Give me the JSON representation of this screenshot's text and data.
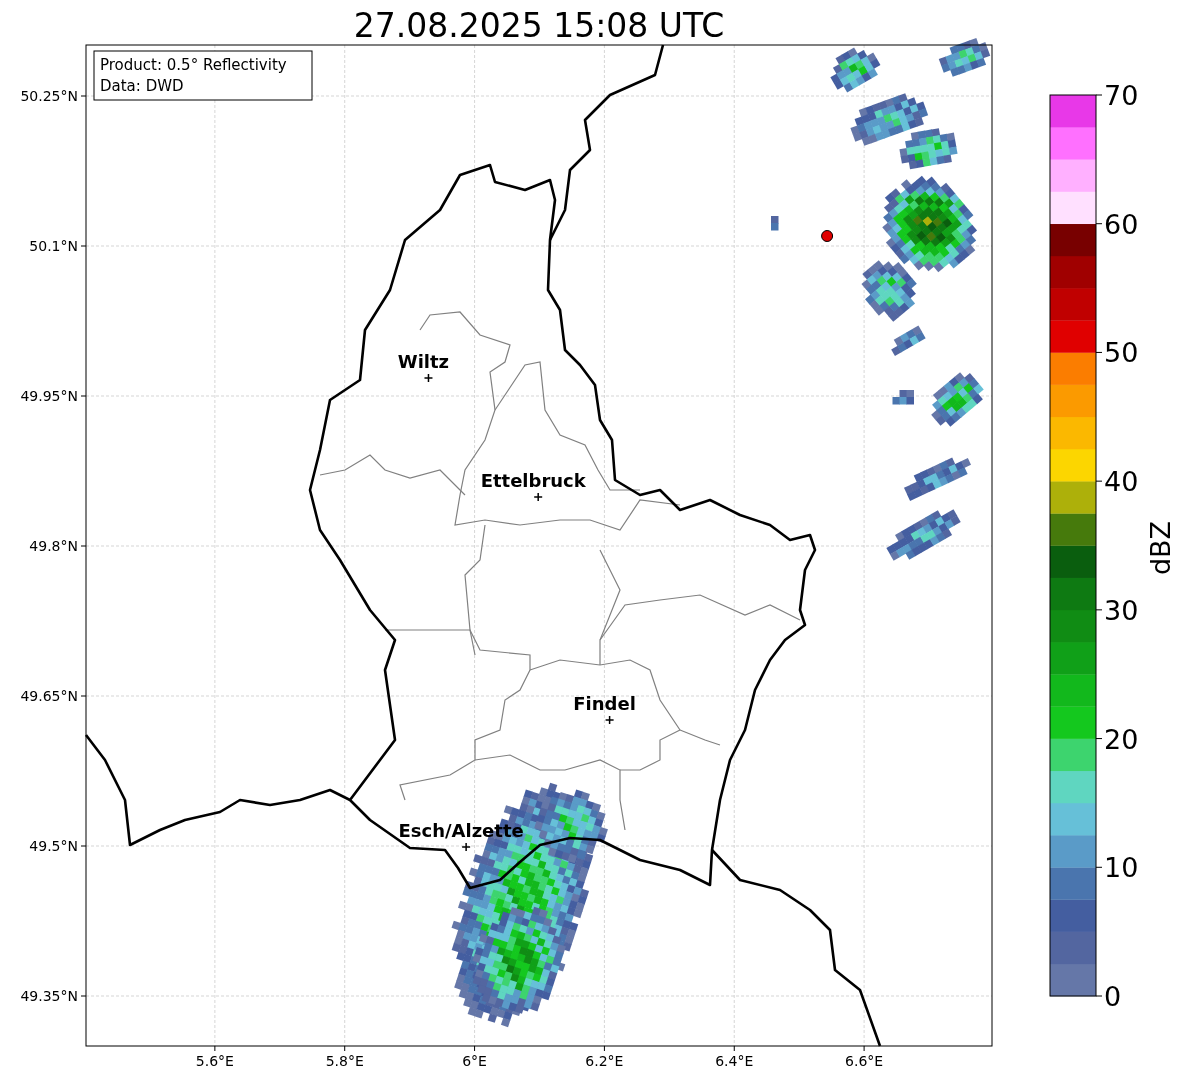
{
  "title": "27.08.2025 15:08 UTC",
  "info_box": [
    "Product: 0.5° Reflectivity",
    "Data: DWD"
  ],
  "map": {
    "chart_data": {
      "type": "scatter",
      "grid": true,
      "xlim": [
        5.4015,
        6.797
      ],
      "ylim": [
        49.3,
        50.301
      ],
      "xticks": [
        {
          "value": 5.6,
          "label": "5.6°E"
        },
        {
          "value": 5.8,
          "label": "5.8°E"
        },
        {
          "value": 6.0,
          "label": "6°E"
        },
        {
          "value": 6.2,
          "label": "6.2°E"
        },
        {
          "value": 6.4,
          "label": "6.4°E"
        },
        {
          "value": 6.6,
          "label": "6.6°E"
        }
      ],
      "yticks": [
        {
          "value": 50.25,
          "label": "50.25°N"
        },
        {
          "value": 50.1,
          "label": "50.1°N"
        },
        {
          "value": 49.95,
          "label": "49.95°N"
        },
        {
          "value": 49.8,
          "label": "49.8°N"
        },
        {
          "value": 49.65,
          "label": "49.65°N"
        },
        {
          "value": 49.5,
          "label": "49.5°N"
        },
        {
          "value": 49.35,
          "label": "49.35°N"
        }
      ],
      "x": [
        5.929,
        6.098,
        6.208,
        5.987,
        6.543
      ],
      "series": [
        {
          "color": "#000000",
          "values": [
            49.968,
            49.849,
            49.626,
            49.499,
            null
          ]
        },
        {
          "color": "#e00000",
          "values": [
            null,
            null,
            null,
            null,
            50.11
          ]
        }
      ],
      "annotations": [
        {
          "text": "Wiltz",
          "x": 5.929,
          "y": 49.968
        },
        {
          "text": "Ettelbruck",
          "x": 6.098,
          "y": 49.849
        },
        {
          "text": "Findel",
          "x": 6.208,
          "y": 49.626
        },
        {
          "text": "Esch/Alzette",
          "x": 5.987,
          "y": 49.499
        }
      ]
    }
  },
  "colorbar": {
    "label": "dBZ",
    "ticks": [
      "70",
      "60",
      "50",
      "40",
      "30",
      "20",
      "10",
      "0"
    ],
    "bands": [
      {
        "color": "#6577a8"
      },
      {
        "color": "#5366a0"
      },
      {
        "color": "#445ea0"
      },
      {
        "color": "#4a75ae"
      },
      {
        "color": "#5a9bc8"
      },
      {
        "color": "#66c0d8"
      },
      {
        "color": "#5fd6c0"
      },
      {
        "color": "#3dd46e"
      },
      {
        "color": "#14c81e"
      },
      {
        "color": "#12b81c"
      },
      {
        "color": "#10a018"
      },
      {
        "color": "#108c14"
      },
      {
        "color": "#0e7a12"
      },
      {
        "color": "#0a5e0e"
      },
      {
        "color": "#467a0c"
      },
      {
        "color": "#adb00a"
      },
      {
        "color": "#fcd600"
      },
      {
        "color": "#fbb800"
      },
      {
        "color": "#fb9a00"
      },
      {
        "color": "#fb7d00"
      },
      {
        "color": "#e00000"
      },
      {
        "color": "#c00000"
      },
      {
        "color": "#a00000"
      },
      {
        "color": "#780000"
      },
      {
        "color": "#ffe0ff"
      },
      {
        "color": "#ffb0ff"
      },
      {
        "color": "#ff70ff"
      },
      {
        "color": "#e838e8"
      }
    ]
  }
}
